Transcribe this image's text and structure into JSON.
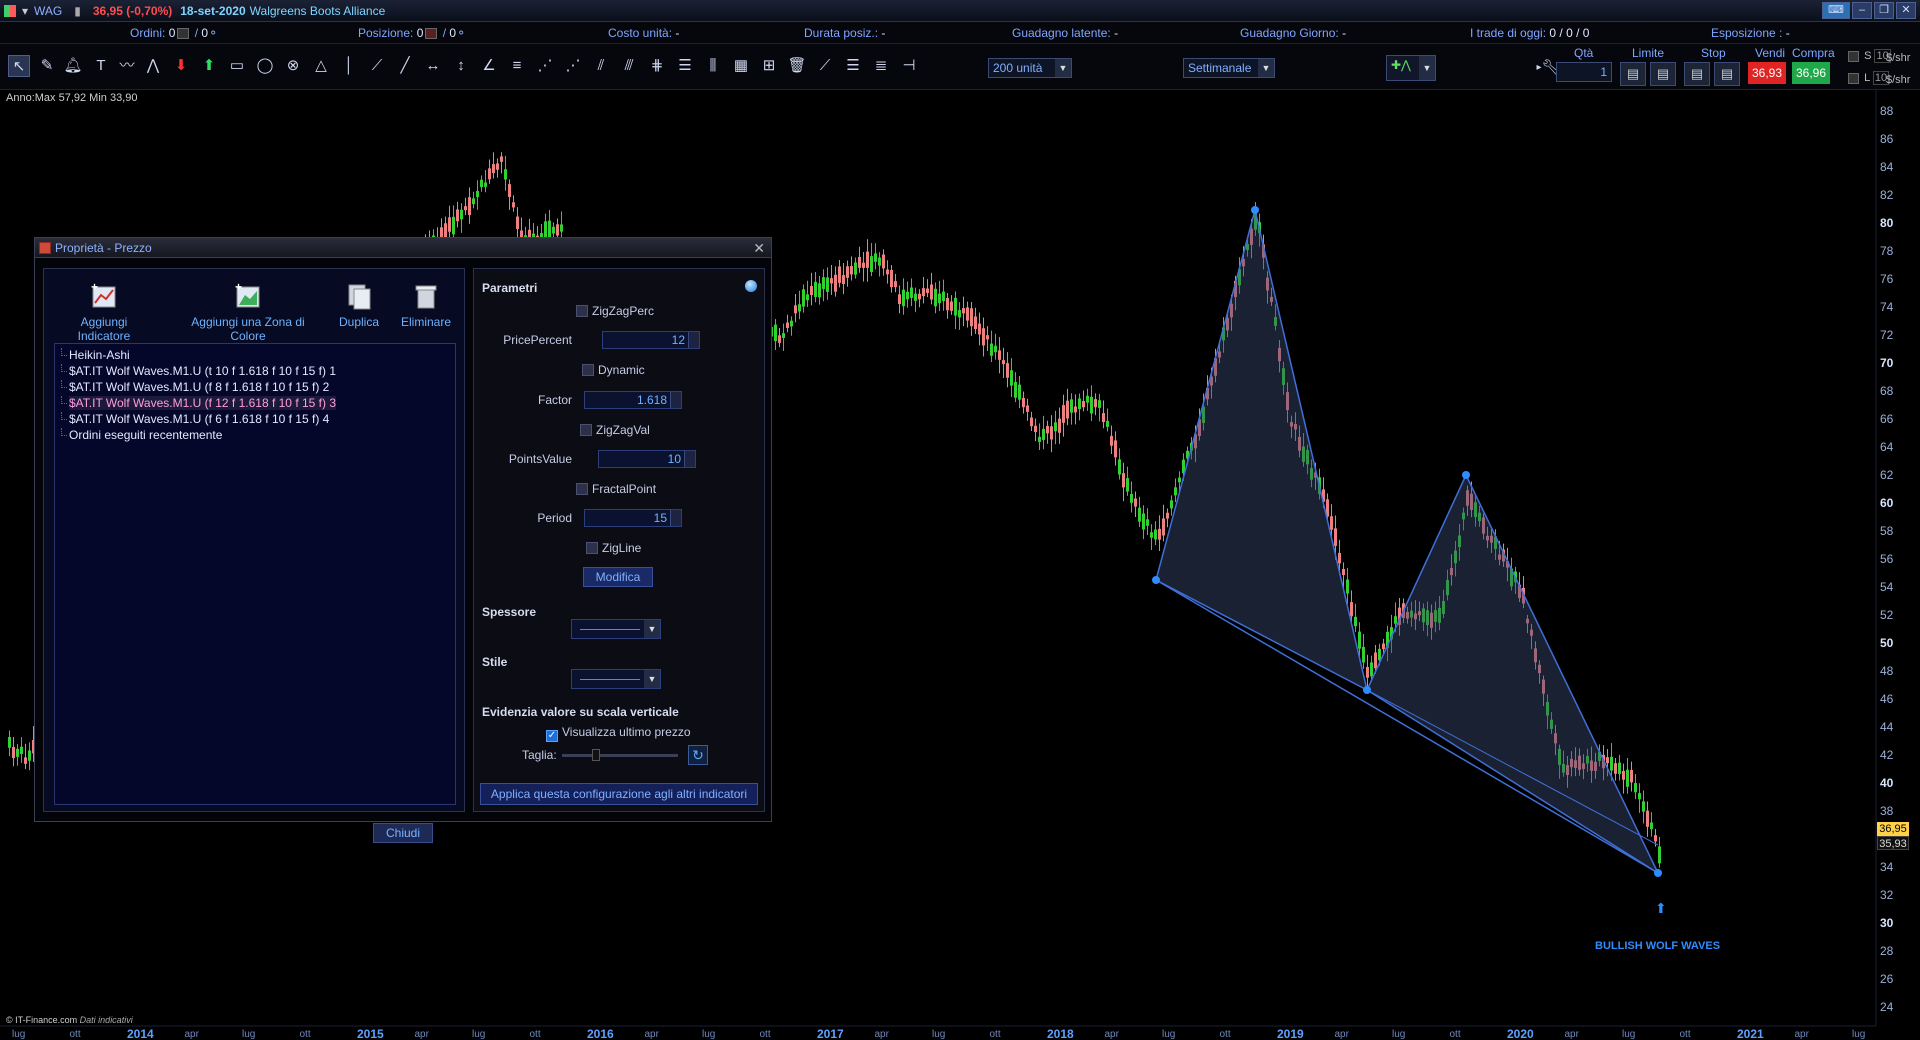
{
  "titlebar": {
    "symbol": "WAG",
    "price_change": "36,95 (-0,70%)",
    "date": "18-set-2020",
    "company": "Walgreens Boots Alliance"
  },
  "infobar": {
    "ordini_label": "Ordini:",
    "ordini_value": "0",
    "ordini_value2": "0",
    "posizione_label": "Posizione:",
    "posizione_value": "0",
    "posizione_value2": "0",
    "costo_label": "Costo unità:",
    "costo_value": "-",
    "durata_label": "Durata posiz.:",
    "durata_value": "-",
    "guadagno_latente_label": "Guadagno latente:",
    "guadagno_latente_value": "-",
    "guadagno_giorno_label": "Guadagno Giorno:",
    "guadagno_giorno_value": "-",
    "trade_oggi_label": "I trade di oggi:",
    "trade_oggi_value": "0 / 0 / 0",
    "esposizione_label": "Esposizione :",
    "esposizione_value": "-"
  },
  "toolbar": {
    "units_select": "200 unità",
    "timeframe_select": "Settimanale",
    "qty_label": "Qtà",
    "qty_value": "1",
    "limit_label": "Limite",
    "stop_label": "Stop",
    "sell_label": "Vendi",
    "buy_label": "Compra",
    "sell_price": "36,93",
    "buy_price": "36,96",
    "s_label": "S",
    "l_label": "L",
    "s_qty": "10",
    "l_qty": "10",
    "shr_label": "$/shr"
  },
  "chart": {
    "annotation": "Anno:Max 57,92 Min 33,90",
    "footer_source": "© IT-Finance.com",
    "footer_note": "Dati indicativi",
    "pattern_label": "BULLISH WOLF WAVES",
    "last_price": "36,95",
    "other_price": "35,93",
    "y_ticks": [
      "88",
      "86",
      "84",
      "82",
      "80",
      "78",
      "76",
      "74",
      "72",
      "70",
      "68",
      "66",
      "64",
      "62",
      "60",
      "58",
      "56",
      "54",
      "52",
      "50",
      "48",
      "46",
      "44",
      "42",
      "40",
      "38",
      "34",
      "32",
      "30",
      "28",
      "26",
      "24"
    ],
    "x_labels": [
      {
        "t": "lug"
      },
      {
        "t": "ott"
      },
      {
        "t": "2014",
        "year": true
      },
      {
        "t": "apr"
      },
      {
        "t": "lug"
      },
      {
        "t": "ott"
      },
      {
        "t": "2015",
        "year": true
      },
      {
        "t": "apr"
      },
      {
        "t": "lug"
      },
      {
        "t": "ott"
      },
      {
        "t": "2016",
        "year": true
      },
      {
        "t": "apr"
      },
      {
        "t": "lug"
      },
      {
        "t": "ott"
      },
      {
        "t": "2017",
        "year": true
      },
      {
        "t": "apr"
      },
      {
        "t": "lug"
      },
      {
        "t": "ott"
      },
      {
        "t": "2018",
        "year": true
      },
      {
        "t": "apr"
      },
      {
        "t": "lug"
      },
      {
        "t": "ott"
      },
      {
        "t": "2019",
        "year": true
      },
      {
        "t": "apr"
      },
      {
        "t": "lug"
      },
      {
        "t": "ott"
      },
      {
        "t": "2020",
        "year": true
      },
      {
        "t": "apr"
      },
      {
        "t": "lug"
      },
      {
        "t": "ott"
      },
      {
        "t": "2021",
        "year": true
      },
      {
        "t": "apr"
      },
      {
        "t": "lug"
      }
    ],
    "colors": {
      "up": "#2fd22f",
      "down": "#f08080",
      "pattern": "#3a5fb0",
      "axis": "#1a2135"
    }
  },
  "dialog": {
    "title": "Proprietà - Prezzo",
    "buttons": {
      "add_indicator": "Aggiungi Indicatore",
      "add_zone": "Aggiungi una Zona di Colore",
      "duplicate": "Duplica",
      "delete": "Eliminare"
    },
    "tree": [
      "Heikin-Ashi",
      "$AT.IT Wolf Waves.M1.U (t 10 f 1.618 f 10 f 15 f) 1",
      "$AT.IT Wolf Waves.M1.U (f 8 f 1.618 f 10 f 15 f) 2",
      "$AT.IT Wolf Waves.M1.U (f 12 f 1.618 f 10 f 15 f) 3",
      "$AT.IT Wolf Waves.M1.U (f 6 f 1.618 f 10 f 15 f) 4",
      "Ordini eseguiti recentemente"
    ],
    "close": "Chiudi",
    "params": {
      "section": "Parametri",
      "zigzagperc": "ZigZagPerc",
      "pricepercent_label": "PricePercent",
      "pricepercent_value": "12",
      "dynamic": "Dynamic",
      "factor_label": "Factor",
      "factor_value": "1.618",
      "zigzagval": "ZigZagVal",
      "pointsvalue_label": "PointsValue",
      "pointsvalue_value": "10",
      "fractalpoint": "FractalPoint",
      "period_label": "Period",
      "period_value": "15",
      "zigline": "ZigLine",
      "modifica": "Modifica",
      "spessore": "Spessore",
      "stile": "Stile",
      "evidenzia": "Evidenzia valore su scala verticale",
      "visualizza": "Visualizza ultimo prezzo",
      "taglia": "Taglia:",
      "apply": "Applica questa configurazione agli altri indicatori"
    }
  }
}
